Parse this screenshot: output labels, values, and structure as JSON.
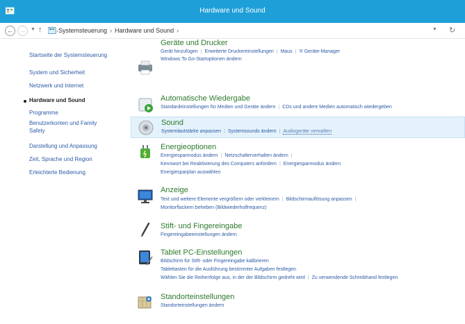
{
  "window": {
    "title": "Hardware und Sound"
  },
  "address_bar": {
    "crumbs": [
      "Systemsteuerung",
      "Hardware und Sound"
    ]
  },
  "sidebar": {
    "items": [
      {
        "label": "Startseite der Systemsteuerung"
      },
      {
        "label": "System und Sicherheit"
      },
      {
        "label": "Netzwerk und Internet"
      },
      {
        "label": "Hardware und Sound",
        "active": true
      },
      {
        "label": "Programme"
      },
      {
        "label": "Benutzerkonten und Family"
      },
      {
        "label": "Safety"
      },
      {
        "label": "Darstellung und Anpassung"
      },
      {
        "label": "Zeit, Sprache und Region"
      },
      {
        "label": "Erleichterte Bedienung"
      }
    ]
  },
  "categories": [
    {
      "title": "Geräte und Drucker",
      "icon": "printer-icon",
      "links": [
        [
          "Gerät hinzufügen",
          "Erweiterte Druckereinstellungen",
          "Maus",
          "Geräte-Manager"
        ],
        [
          "Windows To Go-Startoptionen ändern"
        ]
      ]
    },
    {
      "title": "Automatische Wiedergabe",
      "icon": "autoplay-icon",
      "links": [
        [
          "Standardeinstellungen für Medien und Geräte ändern",
          "CDs und andere Medien automatisch wiedergeben"
        ]
      ]
    },
    {
      "title": "Sound",
      "icon": "speaker-icon",
      "links": [
        [
          "Systemlautstärke anpassen",
          "Systemsounds ändern",
          "Audiogeräte verwalten"
        ]
      ]
    },
    {
      "title": "Energieoptionen",
      "icon": "power-options-icon",
      "links": [
        [
          "Energiesparmodus ändern",
          "Netzschalterverhalten ändern"
        ],
        [
          "Kennwort bei Reaktivierung des Computers anfordern",
          "Energiesparmodus ändern"
        ],
        [
          "Energiesparplan auswählen"
        ]
      ]
    },
    {
      "title": "Anzeige",
      "icon": "display-icon",
      "links": [
        [
          "Text und weitere Elemente vergrößern oder verkleinern",
          "Bildschirmauflösung anpassen"
        ],
        [
          "Monitorflackern beheben (Bildwiederholfrequenz)"
        ]
      ]
    },
    {
      "title": "Stift- und Fingereingabe",
      "icon": "pen-icon",
      "links": [
        [
          "Fingereingabeeinstellungen ändern"
        ]
      ]
    },
    {
      "title": "Tablet PC-Einstellungen",
      "icon": "tablet-icon",
      "links": [
        [
          "Bildschirm für Stift- oder Fingereingabe kalibrieren"
        ],
        [
          "Tablettasten für die Ausführung bestimmter Aufgaben festlegen"
        ],
        [
          "Wählen Sie die Reihenfolge aus, in der der Bildschirm gedreht wird",
          "Zu verwendende Schreibhand festlegen"
        ]
      ]
    },
    {
      "title": "Standorteinstellungen",
      "icon": "location-icon",
      "links": [
        [
          "Standorteinstellungen ändern"
        ]
      ]
    }
  ],
  "colors": {
    "titlebar": "#1f9fd8",
    "link": "#2d5ba5",
    "category_title": "#2d7a2d",
    "highlight_bg": "#e4f2fb"
  }
}
